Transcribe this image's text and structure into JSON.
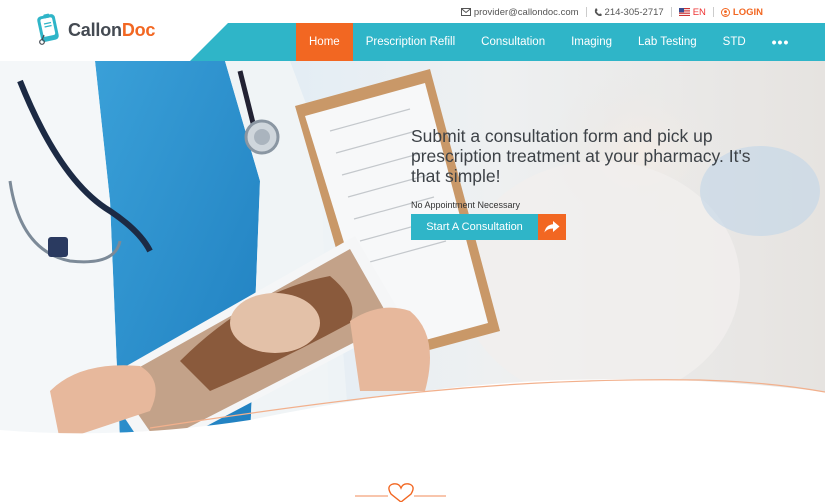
{
  "brand": {
    "name_part1": "Callon",
    "name_part2": "Doc"
  },
  "topbar": {
    "email": "provider@callondoc.com",
    "phone": "214-305-2717",
    "language": "EN",
    "login": "LOGIN"
  },
  "nav": {
    "items": [
      {
        "label": "Home",
        "active": true
      },
      {
        "label": "Prescription Refill"
      },
      {
        "label": "Consultation"
      },
      {
        "label": "Imaging"
      },
      {
        "label": "Lab Testing"
      },
      {
        "label": "STD"
      },
      {
        "label": "•••"
      }
    ]
  },
  "hero": {
    "headline": "Submit a consultation form and pick up prescription treatment at your pharmacy. It's that simple!",
    "subline": "No Appointment Necessary",
    "cta_label": "Start A Consultation"
  },
  "colors": {
    "teal": "#2fb5c8",
    "orange": "#f26722"
  },
  "icons": [
    "envelope-icon",
    "phone-icon",
    "us-flag-icon",
    "user-circle-icon",
    "share-arrow-icon",
    "heart-icon"
  ]
}
